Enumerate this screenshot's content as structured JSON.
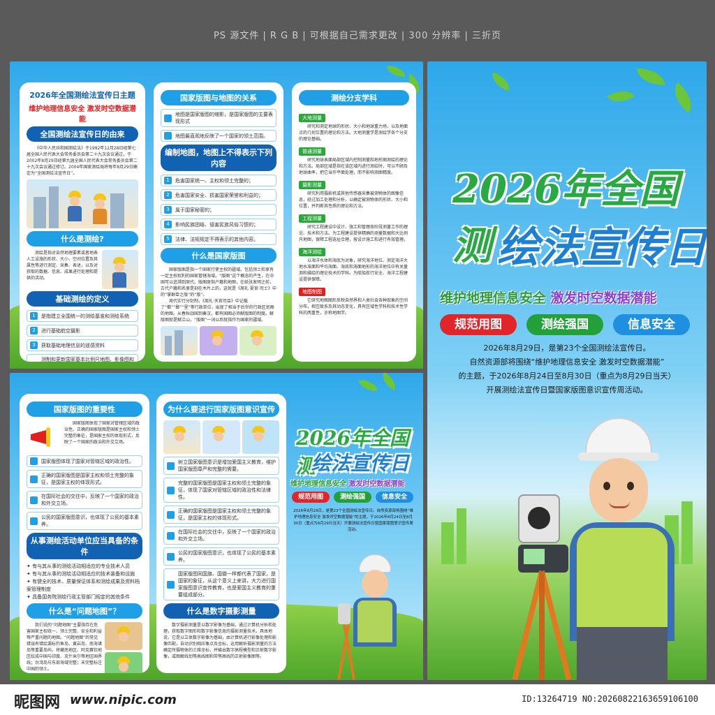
{
  "header_note": "PS 源文件 | R G B | 可根据自己需求更改 | 300 分辨率 | 三折页",
  "colors": {
    "primary_blue": "#1fa0e6",
    "dark_blue": "#1262b3",
    "red": "#e02020",
    "green": "#2aa83c"
  },
  "footer": {
    "site_logo": "昵图网",
    "site_url": "www.nipic.com",
    "image_id": "ID:13264719 NO:20260822163659106100"
  },
  "inner": {
    "left_panel": {
      "title": "2026年全国测绘法宣传日主题",
      "theme": "维护地理信息安全  激发时空数据潜能",
      "origin_header": "全国测绘法宣传日的由来",
      "origin_text": "《中华人民共和国测绘法》于1992年12月28日经第七届全国人民代表大会常务委员会第二十九次会议通过，于2002年8月29日经第九届全国人民代表大会常务委员会第二十九次会议通过修订。2004年国家测绘局将每年8月29日确定为“全国测绘法宣传日”。",
      "what_header": "什么是测绘?",
      "what_text": "测绘是指对自然地理要素或者地表人工设施的形状、大小、空间位置及其属性等进行测定、采集、表述，以及对获取的数据、信息、成果进行处理和提供的活动。",
      "basic_header": "基础测绘的定义",
      "basic_items": [
        {
          "num": "1",
          "text": "是指建立全国统一的测绘基准和测绘系统"
        },
        {
          "num": "2",
          "text": "进行基础航空摄影"
        },
        {
          "num": "3",
          "text": "获取基础地理信息的遥感资料"
        },
        {
          "num": "4",
          "text": "测制和更新国家基本比例尺地图、影像图和数字化产品，建立、更新基础地理信息系统。"
        }
      ]
    },
    "mid_panel": {
      "relation_header": "国家版图与地图的关系",
      "relation_items": [
        "地图是国家版图的缩影，是国家版图的主要表现形式",
        "地图最直观地反映了一个国家的领土范围。"
      ],
      "forbid_header": "编制地图，地图上不得表示下列内容",
      "forbid_items": [
        {
          "num": "1",
          "text": "危害国家统一、主权和领土完整的；"
        },
        {
          "num": "2",
          "text": "危害国家安全、损害国家荣誉和利益的；"
        },
        {
          "num": "3",
          "text": "属于国家秘密的；"
        },
        {
          "num": "4",
          "text": "影响民族团结、侵害民族风俗习惯的；"
        },
        {
          "num": "5",
          "text": "法律、法规规定不得表示的其他内容。"
        }
      ],
      "territory_header": "什么是国家版图",
      "territory_text": "国家版图是指一个国家行使主权的疆域。包括领土和享有一定主权权利的国家管辖海域。“版图”这个概念的产生，在中国可以追溯到周代。版图原指户籍和地图，在纸张发明之前，古代户籍和名册是刻在木片上的，这就是《周礼·夏官·司士》中的“掌群臣之版”的“版”。",
      "territory_text2": "周代实行分封制，《周礼·天官司会》中记载了“都”“鄙”“里”等行政单位，出现了相当于后世的行政区划图的地图。从春秋战国到秦汉，都有国图必须献版图的制度。献版图就是献江山，“版图”一词以后就指作为国家的疆域。"
    },
    "right_panel": {
      "header": "测绘分支学科",
      "branches": [
        {
          "tag": "大地测量",
          "text": "研究和测定地球的形状、大小和地球重力场，以及地面点的几何位置的理论和方法。大地测量学是测绘学各个分支的理论基础。"
        },
        {
          "tag": "普通测量",
          "text": "研究地球表面局部区域内控制测量和地形图测绘的理论和方法。局部区域是指在该区域内进行测绘时，可以不顾及地球曲率，把它当作平面处理，而不影响测图精度。"
        },
        {
          "tag": "摄影测量",
          "text": "研究利用摄影机或其他传感器采集被测物体的图像信息，经过加工处理和分析，以确定被测物体的形状、大小和位置，并判断其性质的理论和方法。"
        },
        {
          "tag": "工程测量",
          "text": "研究工程建设中设计、施工和管理各阶段测量工作的理论、技术和方法。为工程建设提供精确的测量数据和大比例尺地图，保障工程选址合理，按设计施工和进行有效管理。"
        },
        {
          "tag": "海洋测绘",
          "text": "以海洋水体和海底为对象，研究海洋地位、测定海洋大地水准面和平均海面、海底和海面地形的海洋地位中有关量测和描绘的理论技术的学科。为航船航行安全、海洋工程建设提供保障。"
        },
        {
          "tag": "地图制图",
          "text": "它研究地图图形反映自然界和人类社会各种现象的空间分布，相互联系及其动态变化，具有区域性学科和技术性学科的两重性，亦称地图学。"
        }
      ]
    }
  },
  "outer": {
    "left_panel": {
      "importance_header": "国家版图的重要性",
      "importance_intro": "国家版图体现了国家对管辖区域的政治性。正确的国家版图是国家主权和领土完整的象征，是国家主权的体现形式，反映了一个国家的政治和外交立场。",
      "importance_items": [
        "国家版图体现了国家对管辖区域的政治性。",
        "正确的国家版图是国家主权和领土完整的象征，是国家主权的体现形式。",
        "在国际社会的交往中，反映了一个国家的政治和外交立场。",
        "公民的国家版图意识，也体现了公民的基本素养。"
      ],
      "conditions_header": "从事测绘活动单位应当具备的条件",
      "conditions_items": [
        "有与其从事的测绘活动相适应的专业技术人员",
        "有与其从事的测绘活动相适应的技术装备和设施",
        "有健全的技术、质量保证体系和测绘成果及资料档案管理制度",
        "具备国务院测绘行政主管部门规定的其他条件"
      ],
      "problem_header": "什么是“问题地图”？",
      "problem_text": "我们说的“问题地图”主要指存在危害国家主权统一、领土完整、安全和利益等严重问题的地图。“问题地图”的常见错误有错绘漏标钓鱼岛、黄岩岛、南海诸岛等重要岛屿，将藏南地区、阿克赛钦地区绘成中国与印度、克什米尔等地区国界线；台湾岛与东部海域完整；未完整标注中国的领土。"
    },
    "mid_panel": {
      "why_header": "为什么要进行国家版图意识宣传",
      "why_items": [
        "树立国家版图意识是增加爱国主义教育，维护国家版图尊严和完整的需要。",
        "完整的国家版图是国家主权和领土完整的象征，体现了国家对管辖区域的政治性和法律性。",
        "正确的国家版图是国家主权和领土完整的象征，是国家主权的体现形式。",
        "在国际社会的交往中，反映了一个国家的政治和外交立场。",
        "公民的国家版图意识，也体现了公民的基本素养。",
        "国家版图同国旗、国徽一样都代表了国家，是国家的象征，从这个意义上来讲，大力进行国家版图意识宣传教育，也是爱国主义教育的重要组成部分。"
      ],
      "digital_header": "什么是数字摄影测量",
      "digital_text": "数字摄影测量是以数字影像为基础，通过计算机分析和处理，获取数字图形和数字影像信息的摄影测量技术。具体地说，它是以立体数字影像为基础，由计算机进行影像处理和影像匹配，自动识别相应像点及坐标，运用解析摄影测量的方法确定所摄物体的三维坐标，并输出数字高程模型和正射数字影像，或图解线划等高线图和带等高线的正射影像图等。"
    },
    "mini_cover": {
      "title_line1": "2026年全国测",
      "title_line2": "绘法宣传日",
      "slogan_a": "维护地理信息安全",
      "slogan_b": "激发时空数据潜能",
      "pills": [
        "规范用图",
        "测绘强国",
        "信息安全"
      ],
      "body": "2026年8月29日，是第23个全国测绘法宣传日。自然资源部将围绕“维护地理信息安全 激发时空数据潜能”的主题，于2026年8月24日至8月30日（重点为8月29日当天）开展测绘法宣传日暨国家版图意识宣传周活动。"
    }
  },
  "cover": {
    "title_line1": "2026年全国测",
    "title_line2": "绘法宣传日",
    "slogan_a": "维护地理信息安全",
    "slogan_b": "激发时空数据潜能",
    "pills": [
      {
        "label": "规范用图",
        "color": "#e0262a"
      },
      {
        "label": "测绘强国",
        "color": "#24a03a"
      },
      {
        "label": "信息安全",
        "color": "#1f8fe0"
      }
    ],
    "line1": "2026年8月29日，是第23个全国测绘法宣传日。",
    "line2": "自然资源部将围绕“维护地理信息安全 激发时空数据潜能”",
    "line3": "的主题，于2026年8月24日至8月30日（重点为8月29日当天）",
    "line4": "开展测绘法宣传日暨国家版图意识宣传周活动。"
  }
}
